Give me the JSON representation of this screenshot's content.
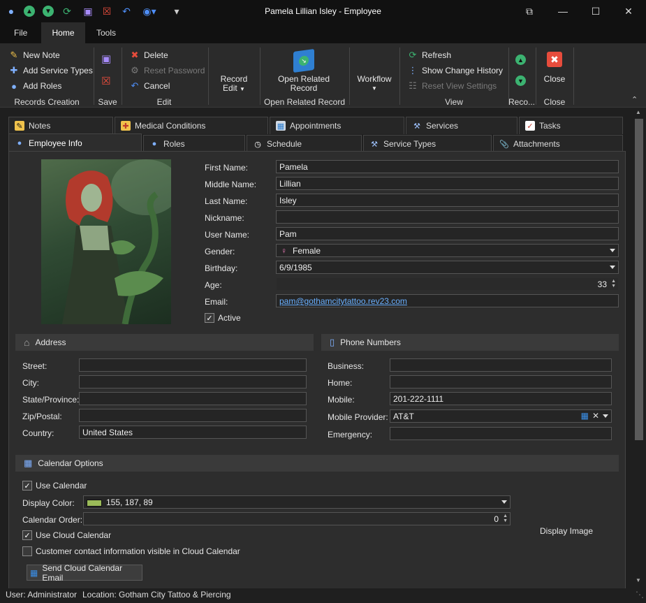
{
  "window": {
    "title": "Pamela Lillian Isley - Employee"
  },
  "ribbon_tabs": [
    {
      "label": "File"
    },
    {
      "label": "Home"
    },
    {
      "label": "Tools"
    }
  ],
  "ribbon": {
    "records_creation": {
      "new_note": "New Note",
      "add_service_types": "Add Service Types",
      "add_roles": "Add Roles",
      "label": "Records Creation"
    },
    "save": {
      "label": "Save"
    },
    "edit": {
      "delete": "Delete",
      "reset_password": "Reset Password",
      "cancel": "Cancel",
      "label": "Edit"
    },
    "record_edit": {
      "line1": "Record",
      "line2": "Edit"
    },
    "open_related": {
      "line1": "Open Related",
      "line2": "Record",
      "label": "Open Related Record"
    },
    "workflow": {
      "label": "Workflow"
    },
    "view": {
      "refresh": "Refresh",
      "show_change_history": "Show Change History",
      "reset_view_settings": "Reset View Settings",
      "label": "View"
    },
    "reco": {
      "label": "Reco..."
    },
    "close": {
      "button": "Close",
      "label": "Close"
    }
  },
  "tabs_row1": [
    "Notes",
    "Medical Conditions",
    "Appointments",
    "Services",
    "Tasks"
  ],
  "tabs_row2": [
    "Employee Info",
    "Roles",
    "Schedule",
    "Service Types",
    "Attachments"
  ],
  "employee": {
    "first_name_label": "First Name:",
    "first_name": "Pamela",
    "middle_name_label": "Middle Name:",
    "middle_name": "Lillian",
    "last_name_label": "Last Name:",
    "last_name": "Isley",
    "nickname_label": "Nickname:",
    "nickname": "",
    "user_name_label": "User Name:",
    "user_name": "Pam",
    "gender_label": "Gender:",
    "gender": "Female",
    "birthday_label": "Birthday:",
    "birthday": "6/9/1985",
    "age_label": "Age:",
    "age": "33",
    "email_label": "Email:",
    "email": "pam@gothamcitytattoo.rev23.com",
    "active_label": "Active",
    "active": true
  },
  "address": {
    "title": "Address",
    "street_label": "Street:",
    "street": "",
    "city_label": "City:",
    "city": "",
    "state_label": "State/Province:",
    "state": "",
    "zip_label": "Zip/Postal:",
    "zip": "",
    "country_label": "Country:",
    "country": "United States"
  },
  "phones": {
    "title": "Phone Numbers",
    "business_label": "Business:",
    "business": "",
    "home_label": "Home:",
    "home": "",
    "mobile_label": "Mobile:",
    "mobile": "201-222-1111",
    "provider_label": "Mobile Provider:",
    "provider": "AT&T",
    "emergency_label": "Emergency:",
    "emergency": ""
  },
  "calendar": {
    "title": "Calendar Options",
    "use_calendar_label": "Use Calendar",
    "use_calendar": true,
    "display_color_label": "Display Color:",
    "display_color": "155, 187, 89",
    "swatch": "#9bbb59",
    "order_label": "Calendar Order:",
    "order": "0",
    "use_cloud_label": "Use Cloud Calendar",
    "use_cloud": true,
    "customer_visible_label": "Customer contact information visible in Cloud Calendar",
    "customer_visible": false,
    "send_email_button": "Send Cloud Calendar Email",
    "display_image_label": "Display Image"
  },
  "status": {
    "user": "User: Administrator",
    "location": "Location: Gotham City Tattoo & Piercing"
  },
  "colors": {
    "accent_green": "#3cb371",
    "close_red": "#e74c3c",
    "save_purple": "#8e6fd8"
  }
}
